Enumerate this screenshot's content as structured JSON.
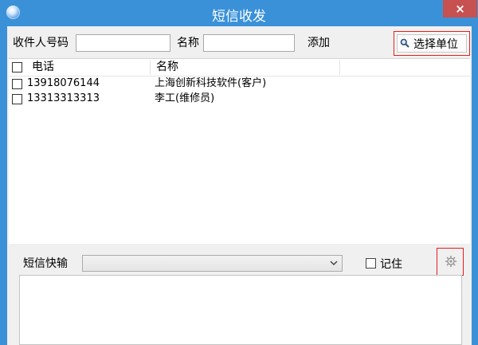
{
  "window": {
    "title": "短信收发",
    "close_label": "×"
  },
  "toolbar": {
    "recipient_label": "收件人号码",
    "recipient_value": "",
    "name_label": "名称",
    "name_value": "",
    "add_label": "添加",
    "select_unit_label": "选择单位"
  },
  "table": {
    "columns": [
      "电话",
      "名称"
    ],
    "rows": [
      {
        "phone": "13918076144",
        "name": "上海创新科技软件(客户)"
      },
      {
        "phone": "13313313313",
        "name": "李工(维修员)"
      }
    ]
  },
  "composer": {
    "quick_label": "短信快输",
    "quick_selected": "",
    "remember_label": "记住",
    "message_value": ""
  },
  "colors": {
    "titlebar": "#3a91d8",
    "close_button": "#c75050",
    "highlight_box": "#e81c1c"
  }
}
